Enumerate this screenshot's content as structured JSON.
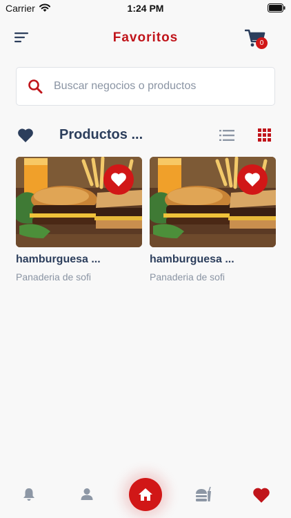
{
  "status_bar": {
    "carrier": "Carrier",
    "time": "1:24 PM"
  },
  "header": {
    "title": "Favoritos",
    "cart_count": "0"
  },
  "search": {
    "placeholder": "Buscar negocios o productos",
    "value": ""
  },
  "section": {
    "title": "Productos ...",
    "active_view": "grid"
  },
  "products": [
    {
      "name": "hamburguesa ...",
      "store": "Panaderia de sofi",
      "favorite": true
    },
    {
      "name": "hamburguesa ...",
      "store": "Panaderia de sofi",
      "favorite": true
    }
  ],
  "bottom_nav": {
    "items": [
      "notifications-icon",
      "profile-icon",
      "home-icon",
      "food-icon",
      "favorites-icon"
    ],
    "active": "favorites"
  },
  "colors": {
    "accent": "#d11717",
    "title_red": "#c0151b",
    "navy": "#2c3e5c",
    "muted": "#8a94a3",
    "nav_gray": "#8d97a5"
  }
}
